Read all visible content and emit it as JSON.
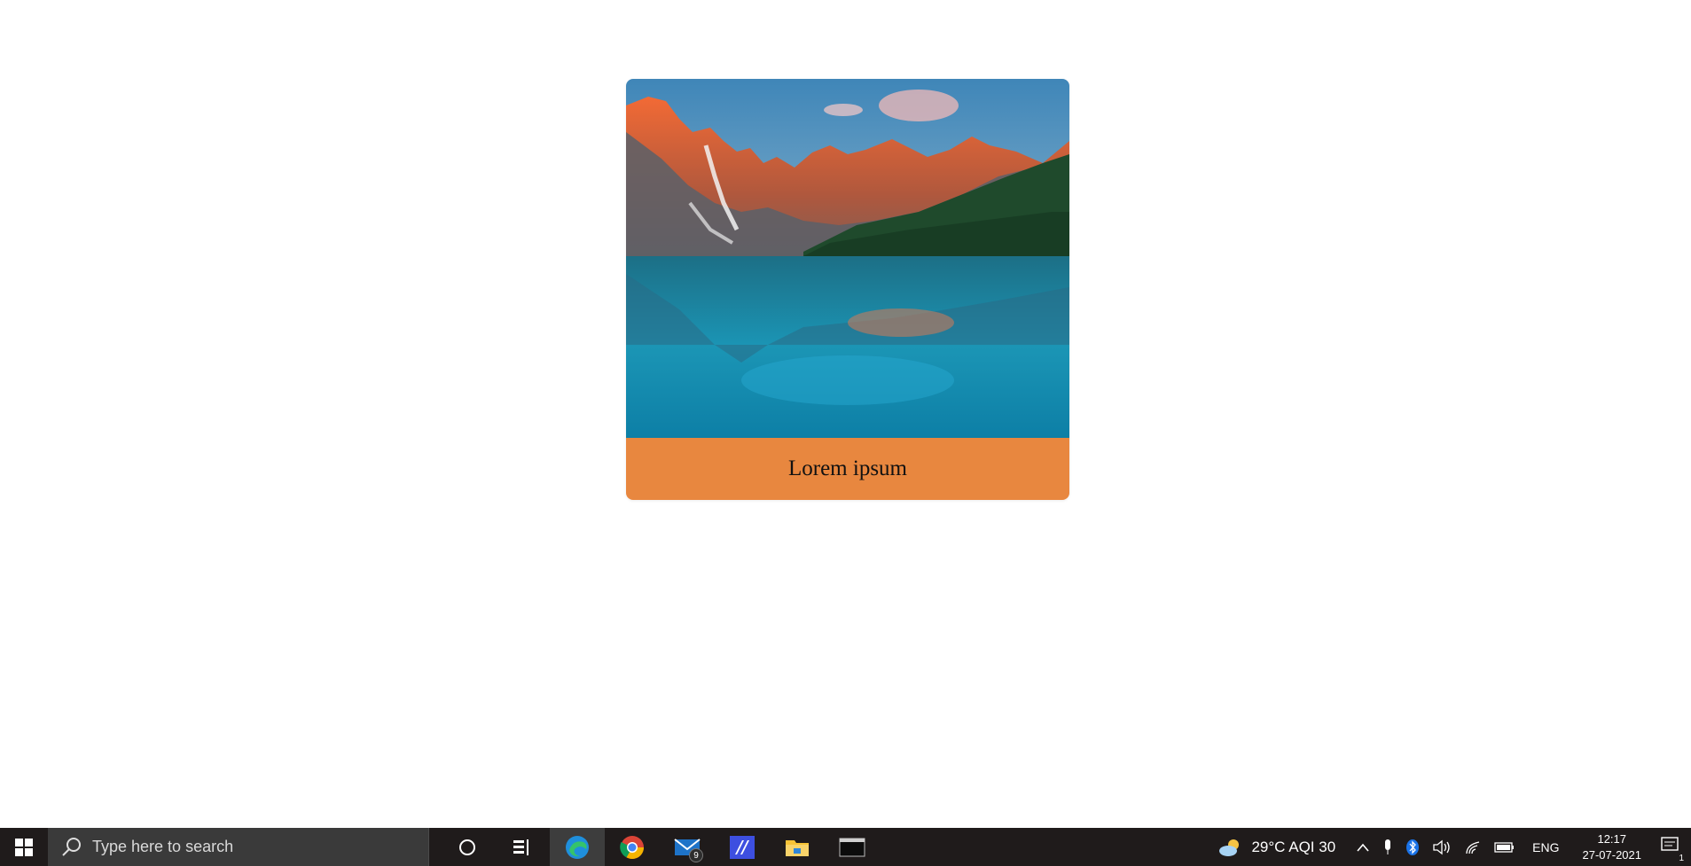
{
  "card": {
    "caption": "Lorem ipsum",
    "footer_color": "#e8873f",
    "image": "mountain-lake-landscape"
  },
  "taskbar": {
    "search_placeholder": "Type here to search",
    "apps": [
      {
        "name": "cortana-icon"
      },
      {
        "name": "task-view-icon"
      },
      {
        "name": "edge-icon",
        "active": true
      },
      {
        "name": "chrome-icon"
      },
      {
        "name": "mail-icon",
        "badge": "9"
      },
      {
        "name": "tool-app-icon"
      },
      {
        "name": "file-explorer-icon"
      },
      {
        "name": "terminal-icon"
      }
    ],
    "weather": "29°C  AQI 30",
    "language": "ENG",
    "time": "12:17",
    "date": "27-07-2021",
    "notification_count": "1"
  }
}
